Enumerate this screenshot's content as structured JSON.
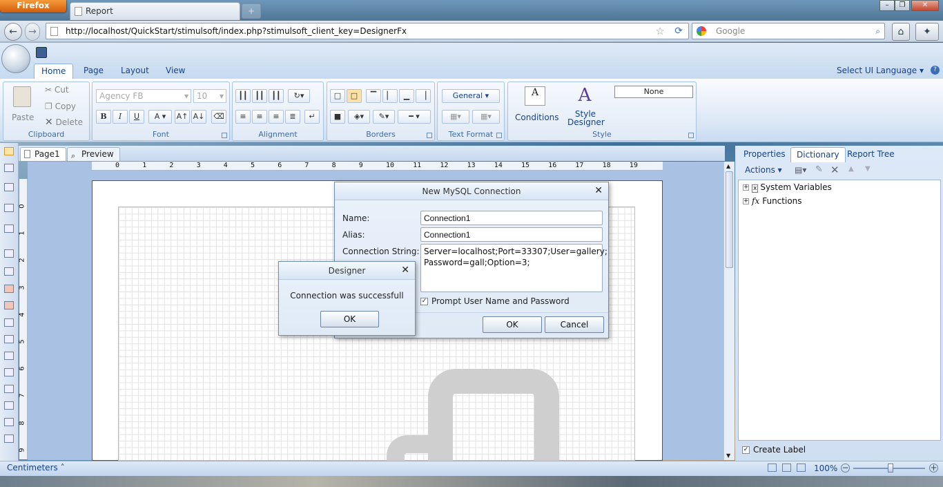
{
  "browser": {
    "menu_button": "Firefox",
    "tab_title": "Report",
    "new_tab": "+",
    "url": "http://localhost/QuickStart/stimulsoft/index.php?stimulsoft_client_key=DesignerFx",
    "search_placeholder": "Google"
  },
  "ribbon": {
    "tabs": [
      "Home",
      "Page",
      "Layout",
      "View"
    ],
    "ui_language": "Select UI Language",
    "clipboard": {
      "paste": "Paste",
      "cut": "Cut",
      "copy": "Copy",
      "delete": "Delete",
      "label": "Clipboard"
    },
    "font": {
      "family": "Agency FB",
      "size": "10",
      "label": "Font",
      "bold": "B",
      "italic": "I",
      "underline": "U"
    },
    "alignment": {
      "label": "Alignment"
    },
    "borders": {
      "label": "Borders"
    },
    "text_format": {
      "value": "General",
      "label": "Text Format"
    },
    "style": {
      "conditions": "Conditions",
      "style_designer": "Style Designer",
      "style_value": "None",
      "label": "Style"
    }
  },
  "workspace": {
    "page_tabs": [
      "Page1",
      "Preview"
    ],
    "ruler_top": [
      "0",
      "1",
      "2",
      "3",
      "4",
      "5",
      "6",
      "7",
      "8",
      "9",
      "10",
      "11",
      "12",
      "13",
      "14",
      "15",
      "16",
      "17",
      "18",
      "19"
    ],
    "ruler_left": [
      "0",
      "1",
      "2",
      "3",
      "4",
      "5",
      "6",
      "7",
      "8",
      "9"
    ]
  },
  "right_panel": {
    "tabs": [
      "Properties",
      "Dictionary",
      "Report Tree"
    ],
    "actions": "Actions",
    "tree": [
      "System Variables",
      "Functions"
    ],
    "create_label": "Create Label"
  },
  "statusbar": {
    "units": "Centimeters",
    "zoom": "100%",
    "zoom_level": 0.5
  },
  "mysql_dialog": {
    "title": "New MySQL Connection",
    "name_label": "Name:",
    "name_value": "Connection1",
    "alias_label": "Alias:",
    "alias_value": "Connection1",
    "connstr_label": "Connection String:",
    "connstr_line1": "Server=localhost;Port=33307;User=gallery;",
    "connstr_line2": "Password=gall;Option=3;",
    "prompt_label": "Prompt User Name and Password",
    "prompt_checked": true,
    "ok": "OK",
    "cancel": "Cancel"
  },
  "designer_dialog": {
    "title": "Designer",
    "message": "Connection was successfull",
    "ok": "OK"
  }
}
